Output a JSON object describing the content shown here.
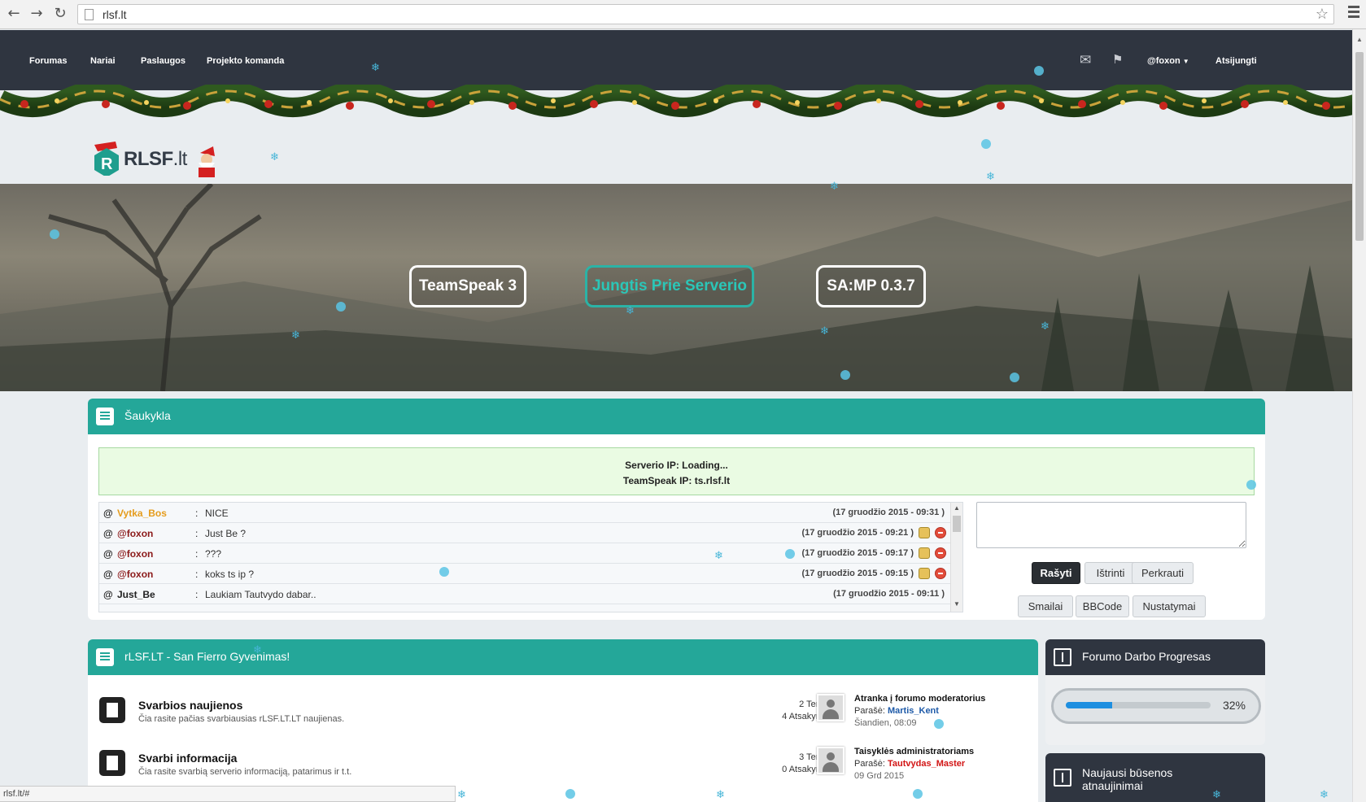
{
  "browser": {
    "url": "rlsf.lt",
    "status_url": "rlsf.lt/#"
  },
  "topnav": {
    "links": [
      "Forumas",
      "Nariai",
      "Paslaugos",
      "Projekto komanda"
    ],
    "user": "@foxon",
    "logout": "Atsijungti"
  },
  "logo": {
    "bold": "RLSF",
    "light": ".lt"
  },
  "hero": {
    "buttons": [
      "TeamSpeak 3",
      "Jungtis Prie Serverio",
      "SA:MP 0.3.7"
    ]
  },
  "shoutbox": {
    "title": "Šaukykla",
    "server_ip": "Serverio IP: Loading...",
    "teamspeak_ip": "TeamSpeak IP: ts.rlsf.lt",
    "rows": [
      {
        "user": "Vytka_Bos",
        "color": "#e59c1c",
        "msg": "NICE",
        "time": "(17 gruodžio 2015 - 09:31 )",
        "actions": false
      },
      {
        "user": "@foxon",
        "color": "#8b1a1a",
        "msg": "Just Be ?",
        "time": "(17 gruodžio 2015 - 09:21 )",
        "actions": true
      },
      {
        "user": "@foxon",
        "color": "#8b1a1a",
        "msg": "???",
        "time": "(17 gruodžio 2015 - 09:17 )",
        "actions": true
      },
      {
        "user": "@foxon",
        "color": "#8b1a1a",
        "msg": "koks ts ip ?",
        "time": "(17 gruodžio 2015 - 09:15 )",
        "actions": true
      },
      {
        "user": "Just_Be",
        "color": "#222222",
        "msg": "Laukiam Tautvydo dabar..",
        "time": "(17 gruodžio 2015 - 09:11 )",
        "actions": false
      }
    ],
    "buttons": {
      "write": "Rašyti",
      "clear": "Ištrinti",
      "reload": "Perkrauti",
      "smilies": "Smailai",
      "bbcode": "BBCode",
      "settings": "Nustatymai"
    }
  },
  "forum": {
    "title": "rLSF.LT - San Fierro Gyvenimas!",
    "rows": [
      {
        "name": "Svarbios naujienos",
        "desc": "Čia rasite pačias svarbiausias rLSF.LT.LT naujienas.",
        "topics": "2 Temų",
        "replies": "4 Atsakymų",
        "last_title": "Atranka į forumo moderatorius",
        "last_by_label": "Parašė:",
        "last_by": "Martis_Kent",
        "last_by_color": "#1e5aa8",
        "last_date": "Šiandien, 08:09"
      },
      {
        "name": "Svarbi informacija",
        "desc": "Čia rasite svarbią serverio informaciją, patarimus ir t.t.",
        "topics": "3 Temų",
        "replies": "0 Atsakymų",
        "last_title": "Taisyklės administratoriams",
        "last_by_label": "Parašė:",
        "last_by": "Tautvydas_Master",
        "last_by_color": "#d21414",
        "last_date": "09 Grd 2015"
      }
    ]
  },
  "progress": {
    "title": "Forumo Darbo Progresas",
    "percent": 32,
    "label": "32%"
  },
  "status_updates": {
    "title": "Naujausi būsenos atnaujinimai"
  },
  "colors": {
    "accent": "#24a799",
    "dark": "#2f3540"
  }
}
